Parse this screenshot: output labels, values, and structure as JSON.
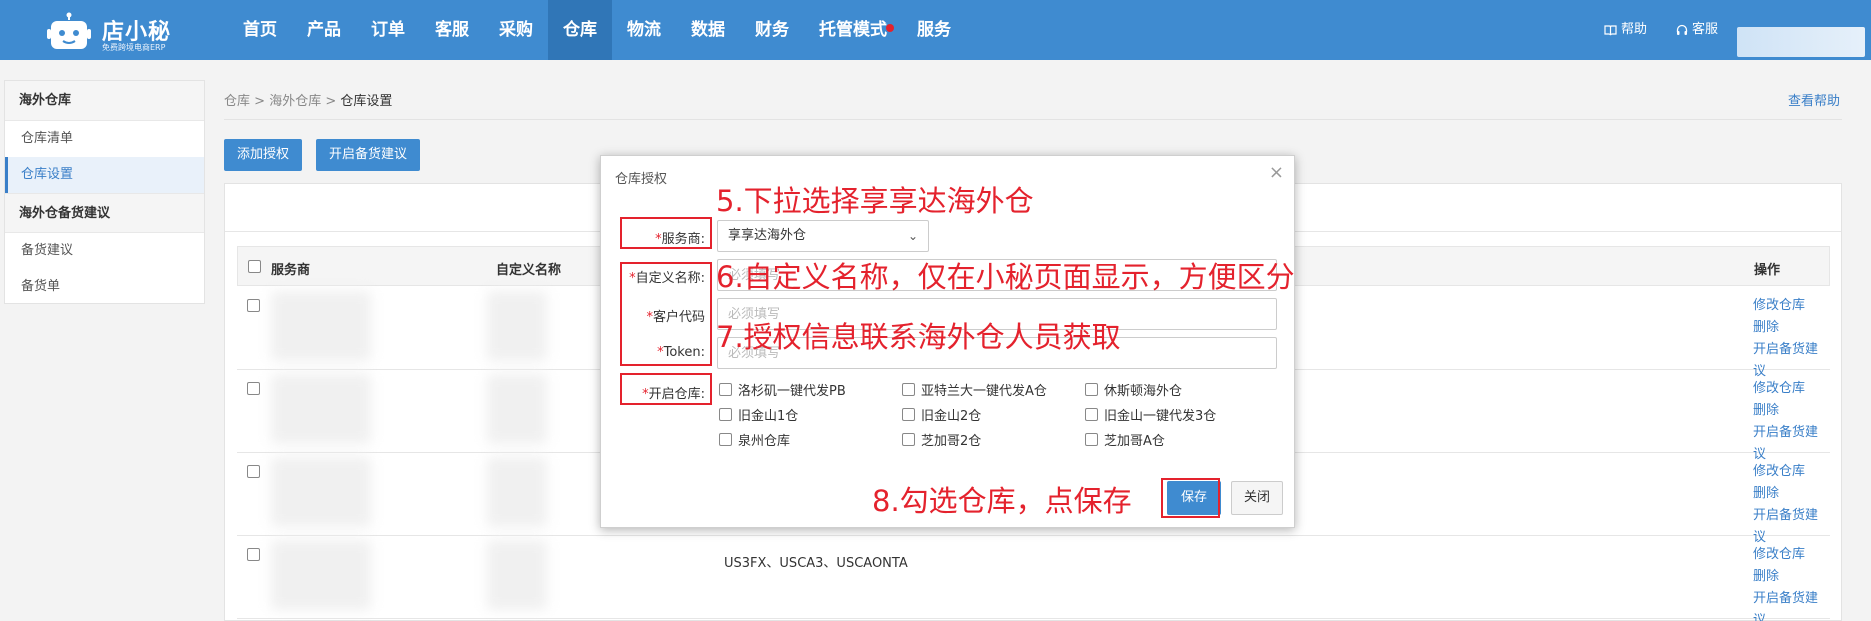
{
  "header": {
    "logo_name": "店小秘",
    "logo_sub": "免费跨境电商ERP",
    "nav": [
      {
        "label": "首页"
      },
      {
        "label": "产品"
      },
      {
        "label": "订单"
      },
      {
        "label": "客服"
      },
      {
        "label": "采购"
      },
      {
        "label": "仓库",
        "active": true
      },
      {
        "label": "物流"
      },
      {
        "label": "数据"
      },
      {
        "label": "财务"
      },
      {
        "label": "托管模式",
        "dot": true
      },
      {
        "label": "服务"
      }
    ],
    "help": "帮助",
    "service": "客服",
    "icons": {
      "help": "book-icon",
      "service": "headset-icon"
    },
    "colors": {
      "bar": "#3f8bd0",
      "active": "#3076b7",
      "dot": "#e4222d"
    }
  },
  "sidebar": {
    "groups": [
      {
        "title": "海外仓库",
        "items": [
          {
            "label": "仓库清单"
          },
          {
            "label": "仓库设置",
            "active": true
          }
        ]
      },
      {
        "title": "海外仓备货建议",
        "items": [
          {
            "label": "备货建议"
          },
          {
            "label": "备货单"
          }
        ]
      }
    ]
  },
  "breadcrumb": {
    "items": [
      "仓库",
      "海外仓库"
    ],
    "current": "仓库设置",
    "separator": ">"
  },
  "help_link": "查看帮助",
  "toolbar": {
    "add_auth": "添加授权",
    "open_stock": "开启备货建议"
  },
  "table": {
    "headers": {
      "provider": "服务商",
      "custom_name": "自定义名称",
      "ops": "操作"
    },
    "ops": [
      "修改仓库",
      "删除",
      "开启备货建议"
    ],
    "row4_warehouses": "US3FX、USCA3、USCAONTA"
  },
  "modal": {
    "title": "仓库授权",
    "close": "×",
    "provider_label": "服务商:",
    "provider_value": "享享达海外仓",
    "name_label": "自定义名称:",
    "name_placeholder": "必须填写",
    "customer_label": "客户代码",
    "customer_placeholder": "必须填写",
    "token_label": "Token:",
    "token_placeholder": "必须填写",
    "warehouse_label": "开启仓库:",
    "warehouses": [
      "洛杉矶一键代发PB",
      "亚特兰大一键代发A仓",
      "休斯顿海外仓",
      "旧金山1仓",
      "旧金山2仓",
      "旧金山一键代发3仓",
      "泉州仓库",
      "芝加哥2仓",
      "芝加哥A仓"
    ],
    "save": "保存",
    "close_btn": "关闭"
  },
  "annotations": {
    "step5": "5.下拉选择享享达海外仓",
    "step6": "6.自定义名称，仅在小秘页面显示，方便区分",
    "step7": "7.授权信息联系海外仓人员获取",
    "step8": "8.勾选仓库，点保存",
    "color": "#e4222d"
  }
}
